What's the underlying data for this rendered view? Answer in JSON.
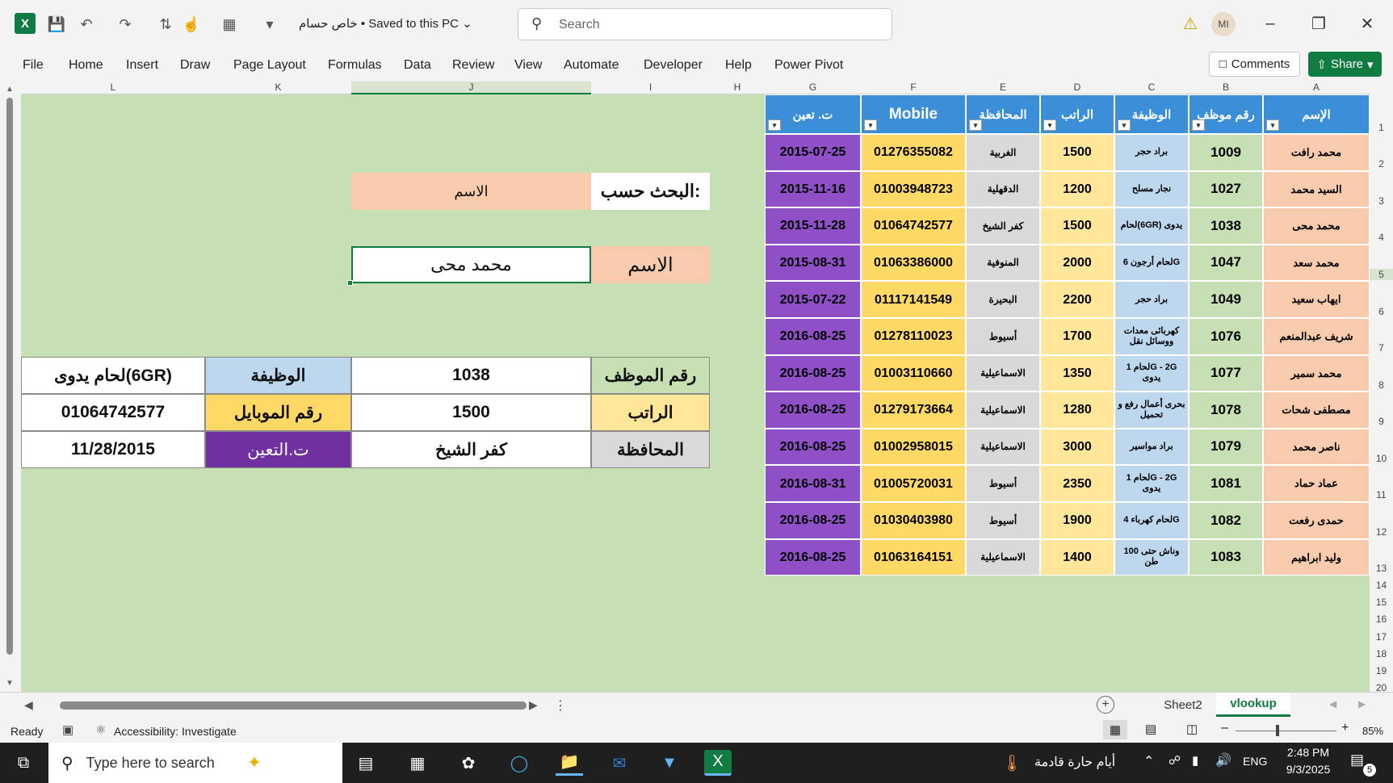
{
  "titlebar": {
    "doc_title": "خاص حسام • Saved to this PC",
    "search_placeholder": "Search",
    "avatar": "MI"
  },
  "menu": [
    "File",
    "Home",
    "Insert",
    "Draw",
    "Page Layout",
    "Formulas",
    "Data",
    "Review",
    "View",
    "Automate",
    "Developer",
    "Help",
    "Power Pivot"
  ],
  "buttons": {
    "comments": "Comments",
    "share": "Share"
  },
  "columns": [
    "L",
    "K",
    "J",
    "I",
    "H",
    "G",
    "F",
    "E",
    "D",
    "C",
    "B",
    "A"
  ],
  "rows": [
    "1",
    "2",
    "3",
    "4",
    "5",
    "6",
    "7",
    "8",
    "9",
    "10",
    "11",
    "12",
    "13",
    "14",
    "15",
    "16",
    "17",
    "18",
    "19",
    "20"
  ],
  "lookup": {
    "search_label": "البحث حسب:",
    "search_value": "الاسم",
    "name_label": "الاسم",
    "name_value": "محمد محى",
    "emp_label": "رقم الموظف",
    "emp_value": "1038",
    "job_label": "الوظيفة",
    "job_value": "لحام يدوى(6GR)",
    "salary_label": "الراتب",
    "salary_value": "1500",
    "mobile_label": "رقم الموبايل",
    "mobile_value": "01064742577",
    "gov_label": "المحافظة",
    "gov_value": "كفر الشيخ",
    "date_label": "ت.التعين",
    "date_value": "11/28/2015"
  },
  "table": {
    "headers": {
      "name": "الإسم",
      "id": "رقم موظف",
      "job": "الوظيفة",
      "salary": "الراتب",
      "gov": "المحافظة",
      "mobile": "Mobile",
      "date": "ت. تعين"
    },
    "rows": [
      {
        "name": "محمد رافت",
        "id": "1009",
        "job": "براد حجر",
        "salary": "1500",
        "gov": "الغربية",
        "mobile": "01276355082",
        "date": "2015-07-25"
      },
      {
        "name": "السيد محمد",
        "id": "1027",
        "job": "نجار مسلح",
        "salary": "1200",
        "gov": "الدقهلية",
        "mobile": "01003948723",
        "date": "2015-11-16"
      },
      {
        "name": "محمد محى",
        "id": "1038",
        "job": "لحام(6GR) يدوى",
        "salary": "1500",
        "gov": "كفر الشيخ",
        "mobile": "01064742577",
        "date": "2015-11-28"
      },
      {
        "name": "محمد سعد",
        "id": "1047",
        "job": "لحام أرجون 6G",
        "salary": "2000",
        "gov": "المنوفية",
        "mobile": "01063386000",
        "date": "2015-08-31"
      },
      {
        "name": "ايهاب سعيد",
        "id": "1049",
        "job": "براد حجر",
        "salary": "2200",
        "gov": "البحيرة",
        "mobile": "01117141549",
        "date": "2015-07-22"
      },
      {
        "name": "شريف عبدالمنعم",
        "id": "1076",
        "job": "كهربائى معدات ووسائل نقل",
        "salary": "1700",
        "gov": "أسيوط",
        "mobile": "01278110023",
        "date": "2016-08-25"
      },
      {
        "name": "محمد سمير",
        "id": "1077",
        "job": "لحام 1G - 2G يدوى",
        "salary": "1350",
        "gov": "الاسماعيلية",
        "mobile": "01003110660",
        "date": "2016-08-25"
      },
      {
        "name": "مصطفى شحات",
        "id": "1078",
        "job": "بحرى أعمال رفع و تحميل",
        "salary": "1280",
        "gov": "الاسماعيلية",
        "mobile": "01279173664",
        "date": "2016-08-25"
      },
      {
        "name": "ناصر محمد",
        "id": "1079",
        "job": "براد مواسير",
        "salary": "3000",
        "gov": "الاسماعيلية",
        "mobile": "01002958015",
        "date": "2016-08-25"
      },
      {
        "name": "عماد حماد",
        "id": "1081",
        "job": "لحام 1G - 2G يدوى",
        "salary": "2350",
        "gov": "أسيوط",
        "mobile": "01005720031",
        "date": "2016-08-31"
      },
      {
        "name": "حمدى رفعت",
        "id": "1082",
        "job": "لحام كهرباء 4G",
        "salary": "1900",
        "gov": "أسيوط",
        "mobile": "01030403980",
        "date": "2016-08-25"
      },
      {
        "name": "وليد ابراهيم",
        "id": "1083",
        "job": "وناش حتى 100 طن",
        "salary": "1400",
        "gov": "الاسماعيلية",
        "mobile": "01063164151",
        "date": "2016-08-25"
      }
    ]
  },
  "sheets": {
    "sheet2": "Sheet2",
    "vlookup": "vlookup"
  },
  "status": {
    "ready": "Ready",
    "accessibility": "Accessibility: Investigate",
    "zoom": "85%"
  },
  "taskbar": {
    "search": "Type here to search",
    "weather": "أيام حارة قادمة",
    "lang": "ENG",
    "time": "2:48 PM",
    "date": "9/3/2025",
    "notif": "5"
  },
  "colors": {
    "header_blue": "#3a8fd8",
    "name_col": "#f8cbad",
    "id_col": "#c6e0b4",
    "job_col": "#bdd7ee",
    "salary_col": "#ffe699",
    "gov_col": "#d9d9d9",
    "mobile_col": "#ffd966",
    "date_col": "#8e4fc7"
  }
}
